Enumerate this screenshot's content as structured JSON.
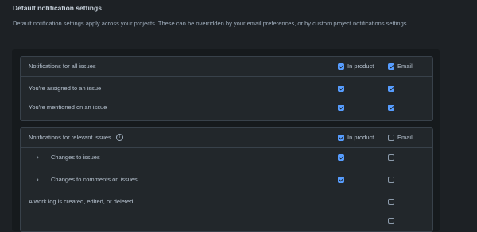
{
  "section": {
    "title": "Default notification settings",
    "description": "Default notification settings apply across your projects. These can be overridden by your email preferences, or by custom project notifications settings."
  },
  "columns": {
    "in_product": "In product",
    "email": "Email"
  },
  "all_issues": {
    "header": "Notifications for all issues",
    "header_in_product": true,
    "header_email": true,
    "rows": [
      {
        "label": "You're assigned to an issue",
        "in_product": true,
        "email": true
      },
      {
        "label": "You're mentioned on an issue",
        "in_product": true,
        "email": true
      }
    ]
  },
  "relevant_issues": {
    "header": "Notifications for relevant issues",
    "header_in_product": true,
    "header_email": false,
    "info_icon": "info-icon",
    "rows": [
      {
        "label": "Changes to issues",
        "expandable": true,
        "in_product": true,
        "email": false
      },
      {
        "label": "Changes to comments on issues",
        "expandable": true,
        "in_product": true,
        "email": false
      },
      {
        "label": "A work log is created, edited, or deleted",
        "expandable": false,
        "in_product": false,
        "email": false
      }
    ]
  },
  "colors": {
    "accent": "#579dff",
    "background": "#1d2125",
    "panel": "#22272b"
  }
}
